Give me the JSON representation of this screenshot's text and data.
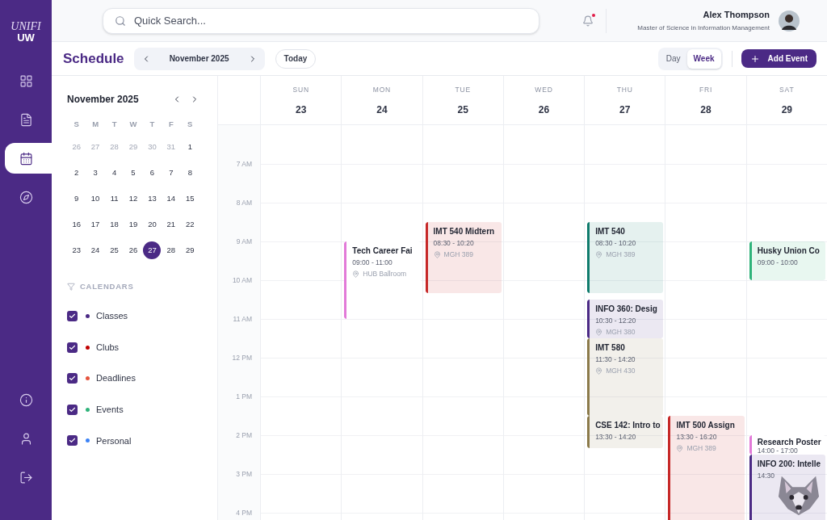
{
  "app": {
    "logo_top": "UNIFI",
    "logo_bottom": "UW"
  },
  "nav": [
    {
      "kind": "grid",
      "selected": false
    },
    {
      "kind": "document",
      "selected": false
    },
    {
      "kind": "calendar",
      "selected": true
    },
    {
      "kind": "compass",
      "selected": false
    }
  ],
  "nav_bottom": [
    {
      "kind": "info"
    },
    {
      "kind": "user"
    },
    {
      "kind": "logout"
    }
  ],
  "header": {
    "search": {
      "placeholder": "Quick Search..."
    },
    "notifications": {
      "unread": true
    },
    "user": {
      "name": "Alex Thompson",
      "program": "Master of Science in Information Management"
    }
  },
  "toolbar": {
    "title": "Schedule",
    "period": "November 2025",
    "today": "Today",
    "views": [
      {
        "label": "Day",
        "selected": false
      },
      {
        "label": "Week",
        "selected": true
      }
    ],
    "add": "Add Event"
  },
  "mini_calendar": {
    "title": "November 2025",
    "weekdays": [
      "S",
      "M",
      "T",
      "W",
      "T",
      "F",
      "S"
    ],
    "weeks": [
      [
        {
          "label": "26",
          "muted": true,
          "selected": false
        },
        {
          "label": "27",
          "muted": true,
          "selected": false
        },
        {
          "label": "28",
          "muted": true,
          "selected": false
        },
        {
          "label": "29",
          "muted": true,
          "selected": false
        },
        {
          "label": "30",
          "muted": true,
          "selected": false
        },
        {
          "label": "31",
          "muted": true,
          "selected": false
        },
        {
          "label": "1",
          "muted": false,
          "selected": false
        }
      ],
      [
        {
          "label": "2",
          "muted": false,
          "selected": false
        },
        {
          "label": "3",
          "muted": false,
          "selected": false
        },
        {
          "label": "4",
          "muted": false,
          "selected": false
        },
        {
          "label": "5",
          "muted": false,
          "selected": false
        },
        {
          "label": "6",
          "muted": false,
          "selected": false
        },
        {
          "label": "7",
          "muted": false,
          "selected": false
        },
        {
          "label": "8",
          "muted": false,
          "selected": false
        }
      ],
      [
        {
          "label": "9",
          "muted": false,
          "selected": false
        },
        {
          "label": "10",
          "muted": false,
          "selected": false
        },
        {
          "label": "11",
          "muted": false,
          "selected": false
        },
        {
          "label": "12",
          "muted": false,
          "selected": false
        },
        {
          "label": "13",
          "muted": false,
          "selected": false
        },
        {
          "label": "14",
          "muted": false,
          "selected": false
        },
        {
          "label": "15",
          "muted": false,
          "selected": false
        }
      ],
      [
        {
          "label": "16",
          "muted": false,
          "selected": false
        },
        {
          "label": "17",
          "muted": false,
          "selected": false
        },
        {
          "label": "18",
          "muted": false,
          "selected": false
        },
        {
          "label": "19",
          "muted": false,
          "selected": false
        },
        {
          "label": "20",
          "muted": false,
          "selected": false
        },
        {
          "label": "21",
          "muted": false,
          "selected": false
        },
        {
          "label": "22",
          "muted": false,
          "selected": false
        }
      ],
      [
        {
          "label": "23",
          "muted": false,
          "selected": false
        },
        {
          "label": "24",
          "muted": false,
          "selected": false
        },
        {
          "label": "25",
          "muted": false,
          "selected": false
        },
        {
          "label": "26",
          "muted": false,
          "selected": false
        },
        {
          "label": "27",
          "muted": false,
          "selected": true
        },
        {
          "label": "28",
          "muted": false,
          "selected": false
        },
        {
          "label": "29",
          "muted": false,
          "selected": false
        }
      ]
    ]
  },
  "calendars": {
    "heading": "CALENDARS",
    "items": [
      {
        "label": "Classes",
        "checked": true,
        "color": "#4b2a85"
      },
      {
        "label": "Clubs",
        "checked": true,
        "color": "#c00000"
      },
      {
        "label": "Deadlines",
        "checked": true,
        "color": "#e5533d"
      },
      {
        "label": "Events",
        "checked": true,
        "color": "#2fb37a"
      },
      {
        "label": "Personal",
        "checked": true,
        "color": "#3b82f6"
      }
    ]
  },
  "hours": [
    "7 AM",
    "8 AM",
    "9 AM",
    "10 AM",
    "11 AM",
    "12 PM",
    "1 PM",
    "2 PM",
    "3 PM",
    "4 PM"
  ],
  "days": [
    {
      "weekday": "SUN",
      "date": "23"
    },
    {
      "weekday": "MON",
      "date": "24",
      "events": [
        {
          "title": "Tech Career Fai",
          "time": "09:00 - 11:00",
          "location": "HUB Ballroom",
          "color": "#e27ad8",
          "filled": false
        }
      ]
    },
    {
      "weekday": "TUE",
      "date": "25",
      "events": [
        {
          "title": "IMT 540 Midtern",
          "time": "08:30 - 10:20",
          "location": "MGH 389",
          "color": "#c62828",
          "filled": true
        }
      ]
    },
    {
      "weekday": "WED",
      "date": "26"
    },
    {
      "weekday": "THU",
      "date": "27",
      "events": [
        {
          "title": "IMT 540",
          "time": "08:30 - 10:20",
          "location": "MGH 389",
          "color": "#0f7b6c",
          "filled": true
        },
        {
          "title": "INFO 360: Desig",
          "time": "10:30 - 12:20",
          "location": "MGH 380",
          "color": "#4b2a85",
          "filled": true
        },
        {
          "title": "IMT 580",
          "time": "11:30 - 14:20",
          "location": "MGH 430",
          "color": "#8b7a4a",
          "filled": true
        },
        {
          "title": "CSE 142: Intro to",
          "time": "13:30 - 14:20",
          "color": "#8b7a4a",
          "filled": true
        }
      ]
    },
    {
      "weekday": "FRI",
      "date": "28",
      "events": [
        {
          "title": "IMT 500 Assign",
          "time": "13:30 - 16:20",
          "location": "MGH 389",
          "color": "#c62828",
          "filled": true
        }
      ]
    },
    {
      "weekday": "SAT",
      "date": "29",
      "events": [
        {
          "title": "Husky Union Co",
          "time": "09:00 - 10:00",
          "color": "#2fb37a",
          "filled": true
        },
        {
          "title": "Research Poster",
          "time": "14:00 - 17:00",
          "color": "#e27ad8",
          "filled": false
        },
        {
          "title": "INFO 200: Intelle",
          "time": "14:30",
          "color": "#4b2a85",
          "filled": true
        }
      ]
    }
  ]
}
